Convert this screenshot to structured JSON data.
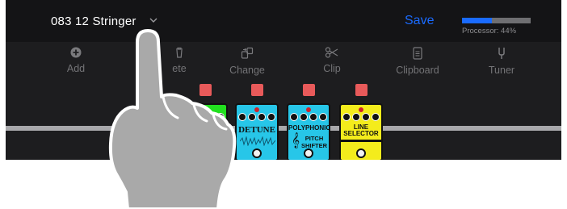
{
  "header": {
    "preset_name": "083 12 Stringer",
    "save_label": "Save",
    "processor_label": "Processor: 44%",
    "processor_fraction": 0.44
  },
  "toolbar": {
    "add": "Add",
    "delete": "ete",
    "change": "Change",
    "clip": "Clip",
    "clipboard": "Clipboard",
    "tuner": "Tuner"
  },
  "pedals": {
    "detune": "DETUNE",
    "polyphonic": "POLYPHONIC",
    "pitch": "PITCH",
    "shifter": "SHIFTER",
    "line": "LINE",
    "selector": "SELECTOR"
  },
  "colors": {
    "accent": "#1a6bff",
    "select_marker": "#e85a5a",
    "green_pedal": "#22e01f",
    "cyan_pedal": "#27c6e8",
    "yellow_pedal": "#f4ec1c"
  }
}
